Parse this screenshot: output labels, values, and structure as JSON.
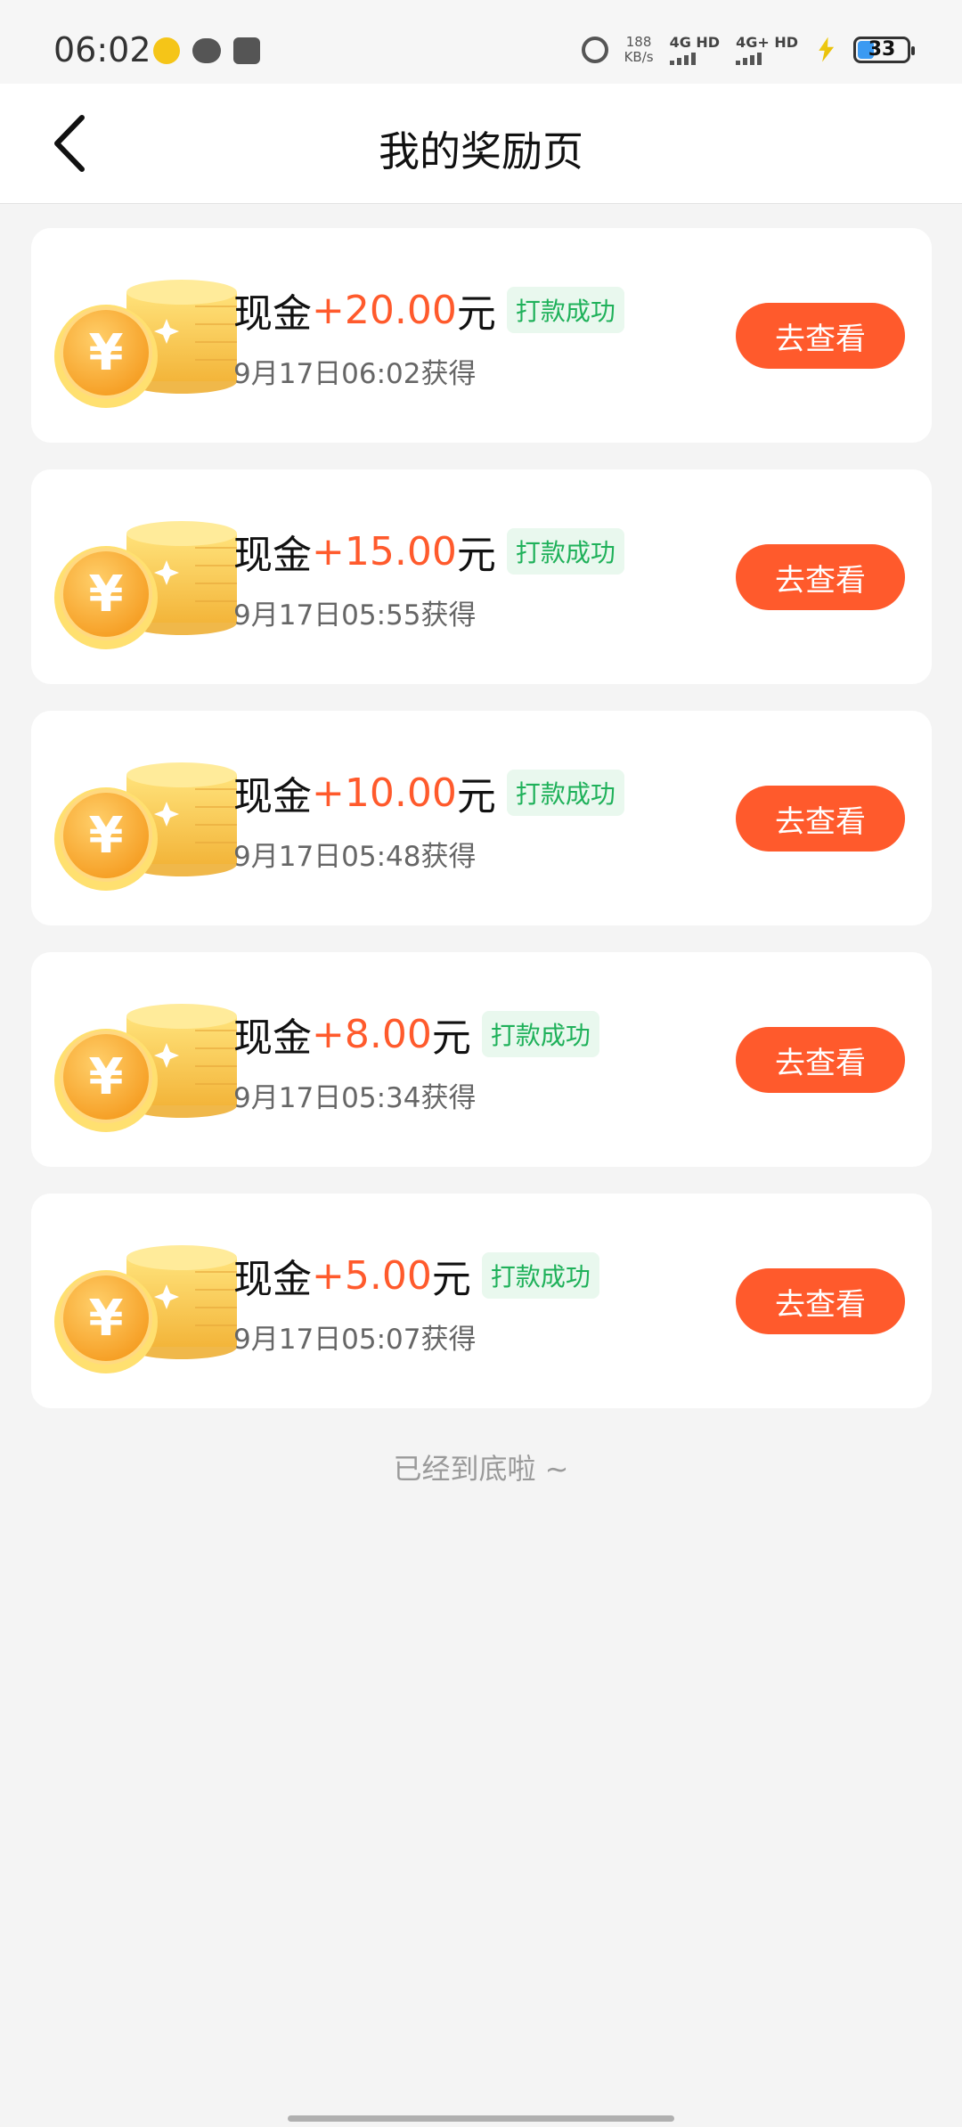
{
  "status_bar": {
    "time": "06:02",
    "net_speed": "188",
    "net_speed_unit": "KB/s",
    "network_1": "4G HD",
    "network_2": "4G+ HD",
    "battery": "33",
    "battery_color": "#3b9af2"
  },
  "header": {
    "title": "我的奖励页",
    "back_icon": "chevron-left-icon"
  },
  "rewards": [
    {
      "label": "现金",
      "amount": "+20.00",
      "unit": "元",
      "status": "打款成功",
      "time": "9月17日06:02获得",
      "button": "去查看"
    },
    {
      "label": "现金",
      "amount": "+15.00",
      "unit": "元",
      "status": "打款成功",
      "time": "9月17日05:55获得",
      "button": "去查看"
    },
    {
      "label": "现金",
      "amount": "+10.00",
      "unit": "元",
      "status": "打款成功",
      "time": "9月17日05:48获得",
      "button": "去查看"
    },
    {
      "label": "现金",
      "amount": "+8.00",
      "unit": "元",
      "status": "打款成功",
      "time": "9月17日05:34获得",
      "button": "去查看"
    },
    {
      "label": "现金",
      "amount": "+5.00",
      "unit": "元",
      "status": "打款成功",
      "time": "9月17日05:07获得",
      "button": "去查看"
    }
  ],
  "coin_icon": "yuan-coin-stack-icon",
  "footer": {
    "end_text": "已经到底啦 ~"
  },
  "colors": {
    "accent": "#ff5a2c",
    "success": "#1fb15a",
    "success_bg": "#e9f8ee",
    "background": "#f4f4f4"
  }
}
